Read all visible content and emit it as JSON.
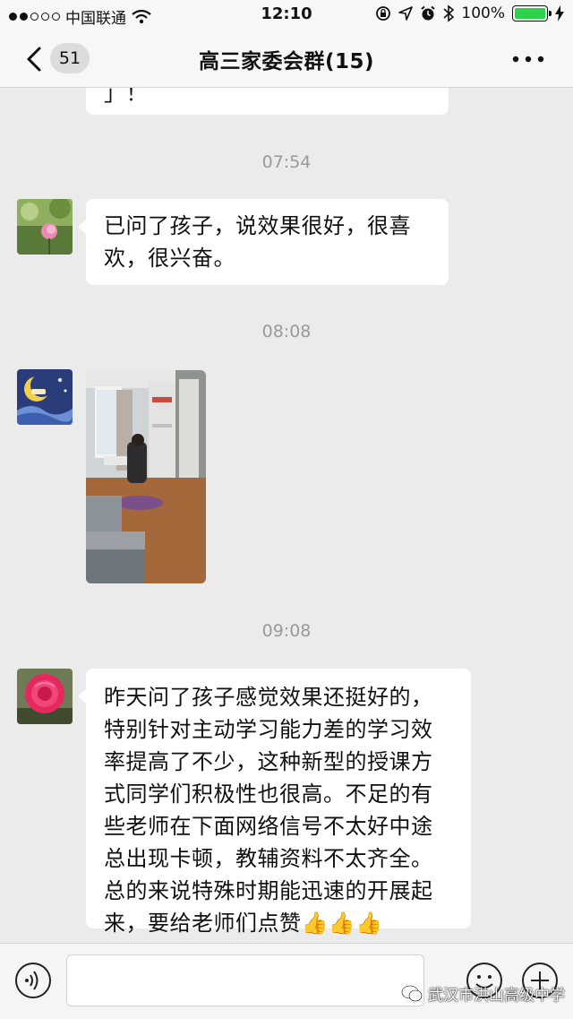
{
  "status_bar": {
    "carrier": "中国联通",
    "time": "12:10",
    "battery": "100%",
    "battery_level": 1.0
  },
  "nav": {
    "back_count": "51",
    "title": "高三家委会群(15)"
  },
  "messages": [
    {
      "text_top": "」！"
    },
    {
      "time": "07:54",
      "text": "已问了孩子，说效果很好，很喜欢，很兴奋。"
    },
    {
      "time": "08:08"
    },
    {
      "time": "09:08",
      "text": "昨天问了孩子感觉效果还挺好的，特别针对主动学习能力差的学习效率提高了不少，这种新型的授课方式同学们积极性也很高。不足的有些老师在下面网络信号不太好中途总出现卡顿，教辅资料不太齐全。总的来说特殊时期能迅速的开展起来，要给老师们点赞👍👍👍"
    }
  ],
  "watermark": "武汉市洪山高级中学",
  "colors": {
    "background": "#ebebeb",
    "bubble": "#ffffff",
    "battery": "#2bd24a",
    "timestamp": "#9a9a9a"
  },
  "icons": [
    "chevron-left-icon",
    "more-dots-icon",
    "voice-icon",
    "emoji-icon",
    "plus-icon",
    "wifi-icon",
    "bluetooth-icon",
    "alarm-icon",
    "location-icon",
    "lock-rotation-icon",
    "wechat-icon"
  ]
}
